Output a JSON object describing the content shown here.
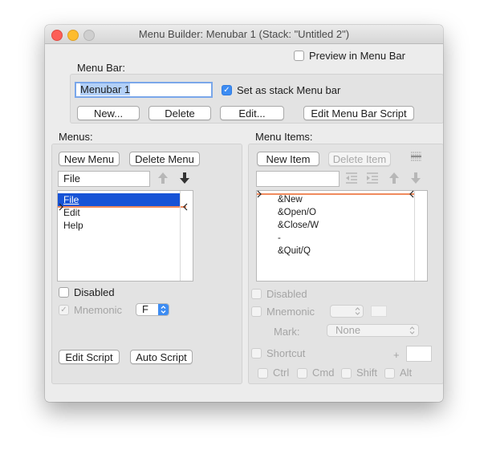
{
  "window": {
    "title": "Menu Builder: Menubar 1 (Stack: \"Untitled 2\")",
    "preview_label": "Preview in Menu Bar"
  },
  "menubar": {
    "section_label": "Menu Bar:",
    "name_value": "Menubar 1",
    "stack_menu_label": "Set as stack Menu bar",
    "new_label": "New...",
    "delete_label": "Delete",
    "edit_label": "Edit...",
    "edit_script_label": "Edit Menu Bar Script"
  },
  "menus": {
    "section_label": "Menus:",
    "new_menu_label": "New Menu",
    "delete_menu_label": "Delete Menu",
    "name_value": "File",
    "items": [
      "File",
      "Edit",
      "Help"
    ],
    "disabled_label": "Disabled",
    "mnemonic_label": "Mnemonic",
    "mnemonic_value": "F",
    "edit_script_label": "Edit Script",
    "auto_script_label": "Auto Script"
  },
  "menu_items": {
    "section_label": "Menu Items:",
    "new_item_label": "New Item",
    "delete_item_label": "Delete Item",
    "items": [
      "&New",
      "&Open/O",
      "&Close/W",
      "-",
      "&Quit/Q"
    ],
    "disabled_label": "Disabled",
    "mnemonic_label": "Mnemonic",
    "mark_label": "Mark:",
    "mark_value": "None",
    "shortcut_label": "Shortcut",
    "plus_label": "+",
    "ctrl_label": "Ctrl",
    "cmd_label": "Cmd",
    "shift_label": "Shift",
    "alt_label": "Alt"
  },
  "colors": {
    "selection": "#1753d6",
    "insertion_line": "#f08a5d",
    "checkbox_on": "#3d8cf2"
  }
}
